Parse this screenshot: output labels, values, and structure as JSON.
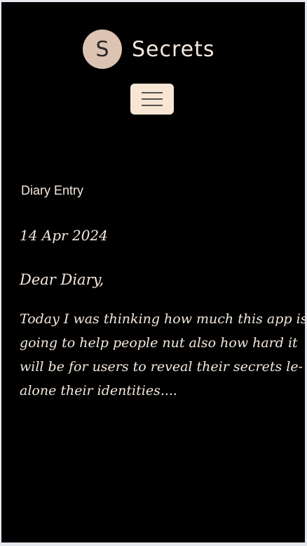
{
  "header": {
    "logo_letter": "S",
    "brand_name": "Secrets"
  },
  "menu": {
    "icon": "hamburger-menu-icon"
  },
  "entry": {
    "section_title": "Diary Entry",
    "date": "14 Apr 2024",
    "salutation": "Dear Diary,",
    "body_lines": [
      "Today I was thinking how much this app is",
      "going to help people nut also how hard it",
      "will be for users to reveal their secrets le-",
      "alone their identities...."
    ]
  },
  "colors": {
    "background": "#000000",
    "logo_circle": "#dcc3b2",
    "menu_button": "#f6e6d3",
    "text": "#f3e8de"
  }
}
